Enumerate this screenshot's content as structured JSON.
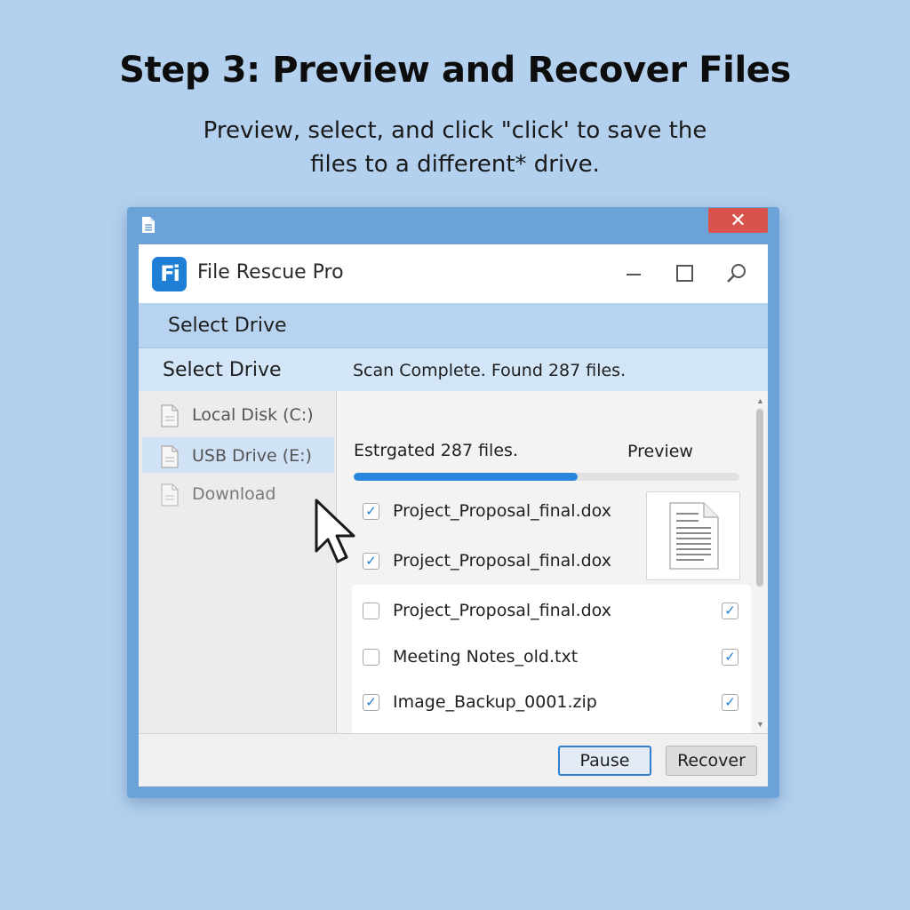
{
  "page": {
    "headline": "Step 3: Preview and Recover Files",
    "subtitle_line1": "Preview, select, and click \"click' to save the",
    "subtitle_line2": "files to a different* drive."
  },
  "window": {
    "close_glyph": "✕",
    "app_logo_text": "Fi",
    "app_title": "File Rescue Pro",
    "icons": [
      "document-icon",
      "minimize-icon",
      "maximize-icon",
      "search-icon",
      "close-icon"
    ]
  },
  "toolbar": {
    "band_label": "Select Drive",
    "section_label": "Select Drive",
    "status_text": "Scan Complete. Found 287 files."
  },
  "sidebar": {
    "items": [
      {
        "label": "Local Disk (C:)",
        "selected": false
      },
      {
        "label": "USB Drive (E:)",
        "selected": true
      },
      {
        "label": "Download",
        "selected": false
      }
    ]
  },
  "main": {
    "estimate_text": "Estrgated 287 files.",
    "preview_label": "Preview",
    "progress_percent": 58,
    "top_files": [
      {
        "name": "Project_Proposal_final.dox",
        "checked": true
      },
      {
        "name": "Project_Proposal_final.dox",
        "checked": true
      }
    ],
    "list_files": [
      {
        "name": "Project_Proposal_final.dox",
        "checked": false,
        "right_checked": true
      },
      {
        "name": "Meeting Notes_old.txt",
        "checked": false,
        "right_checked": true
      },
      {
        "name": "Image_Backup_0001.zip",
        "checked": true,
        "right_checked": true
      }
    ],
    "check_glyph": "✓"
  },
  "footer": {
    "pause_label": "Pause",
    "recover_label": "Recover"
  },
  "colors": {
    "accent": "#2a86dc",
    "close": "#d9534d",
    "background": "#b3d1ee"
  }
}
